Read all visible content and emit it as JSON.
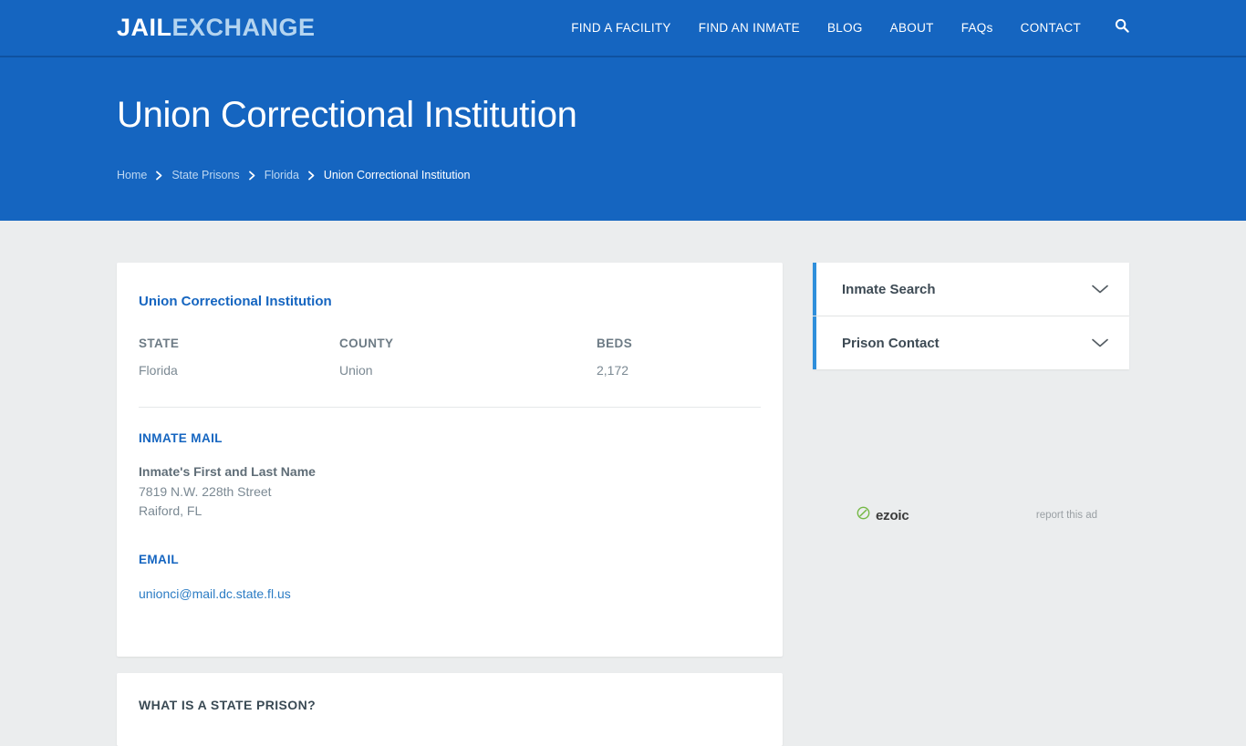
{
  "header": {
    "logo_primary": "JAIL",
    "logo_secondary": "EXCHANGE",
    "nav": [
      {
        "label": "FIND A FACILITY"
      },
      {
        "label": "FIND AN INMATE"
      },
      {
        "label": "BLOG"
      },
      {
        "label": "ABOUT"
      },
      {
        "label": "FAQs"
      },
      {
        "label": "CONTACT"
      }
    ],
    "search_icon": "search-icon",
    "background_color": "#1565c0"
  },
  "hero": {
    "title": "Union Correctional Institution",
    "breadcrumb": [
      {
        "label": "Home",
        "current": false
      },
      {
        "label": "State Prisons",
        "current": false
      },
      {
        "label": "Florida",
        "current": false
      },
      {
        "label": "Union Correctional Institution",
        "current": true
      }
    ]
  },
  "main": {
    "facility_name": "Union Correctional Institution",
    "stats": [
      {
        "label": "STATE",
        "value": "Florida"
      },
      {
        "label": "COUNTY",
        "value": "Union"
      },
      {
        "label": "BEDS",
        "value": "2,172"
      }
    ],
    "inmate_mail": {
      "heading": "INMATE MAIL",
      "recipient": "Inmate's First and Last Name",
      "street": "7819 N.W. 228th Street",
      "city_state": "Raiford, FL"
    },
    "email": {
      "heading": "EMAIL",
      "address": "unionci@mail.dc.state.fl.us",
      "link_color": "#2b7cc4"
    },
    "secondary_card": {
      "title": "WHAT IS A STATE PRISON?"
    }
  },
  "sidebar": {
    "accordions": [
      {
        "label": "Inmate Search",
        "icon": "chevron-down-icon",
        "expanded": false
      },
      {
        "label": "Prison Contact",
        "icon": "chevron-down-icon",
        "expanded": false
      }
    ],
    "accent_color": "#2f8fdb"
  },
  "ad": {
    "provider": "ezoic",
    "report_label": "report this ad",
    "icon_color": "#76b947"
  }
}
